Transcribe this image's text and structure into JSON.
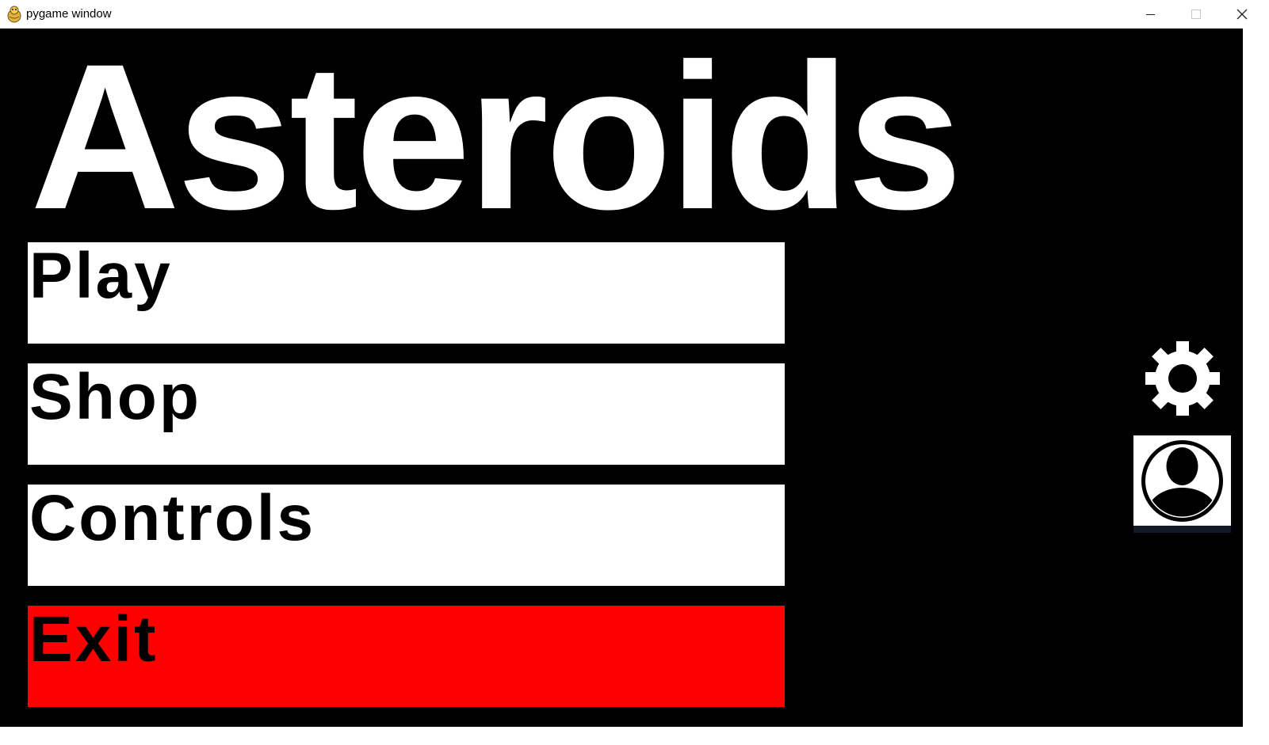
{
  "window": {
    "title": "pygame window",
    "icon": "pygame-snake-icon",
    "controls": [
      "minimize-icon",
      "maximize-icon",
      "close-icon"
    ]
  },
  "game": {
    "title": "Asteroids",
    "menu": [
      {
        "label": "Play"
      },
      {
        "label": "Shop"
      },
      {
        "label": "Controls"
      },
      {
        "label": "Exit"
      }
    ],
    "side_icons": [
      "gear-icon",
      "user-profile-icon"
    ]
  },
  "colors": {
    "background": "#000000",
    "button": "#ffffff",
    "exit_button": "#ff0000",
    "text": "#000000",
    "title_text": "#ffffff"
  }
}
